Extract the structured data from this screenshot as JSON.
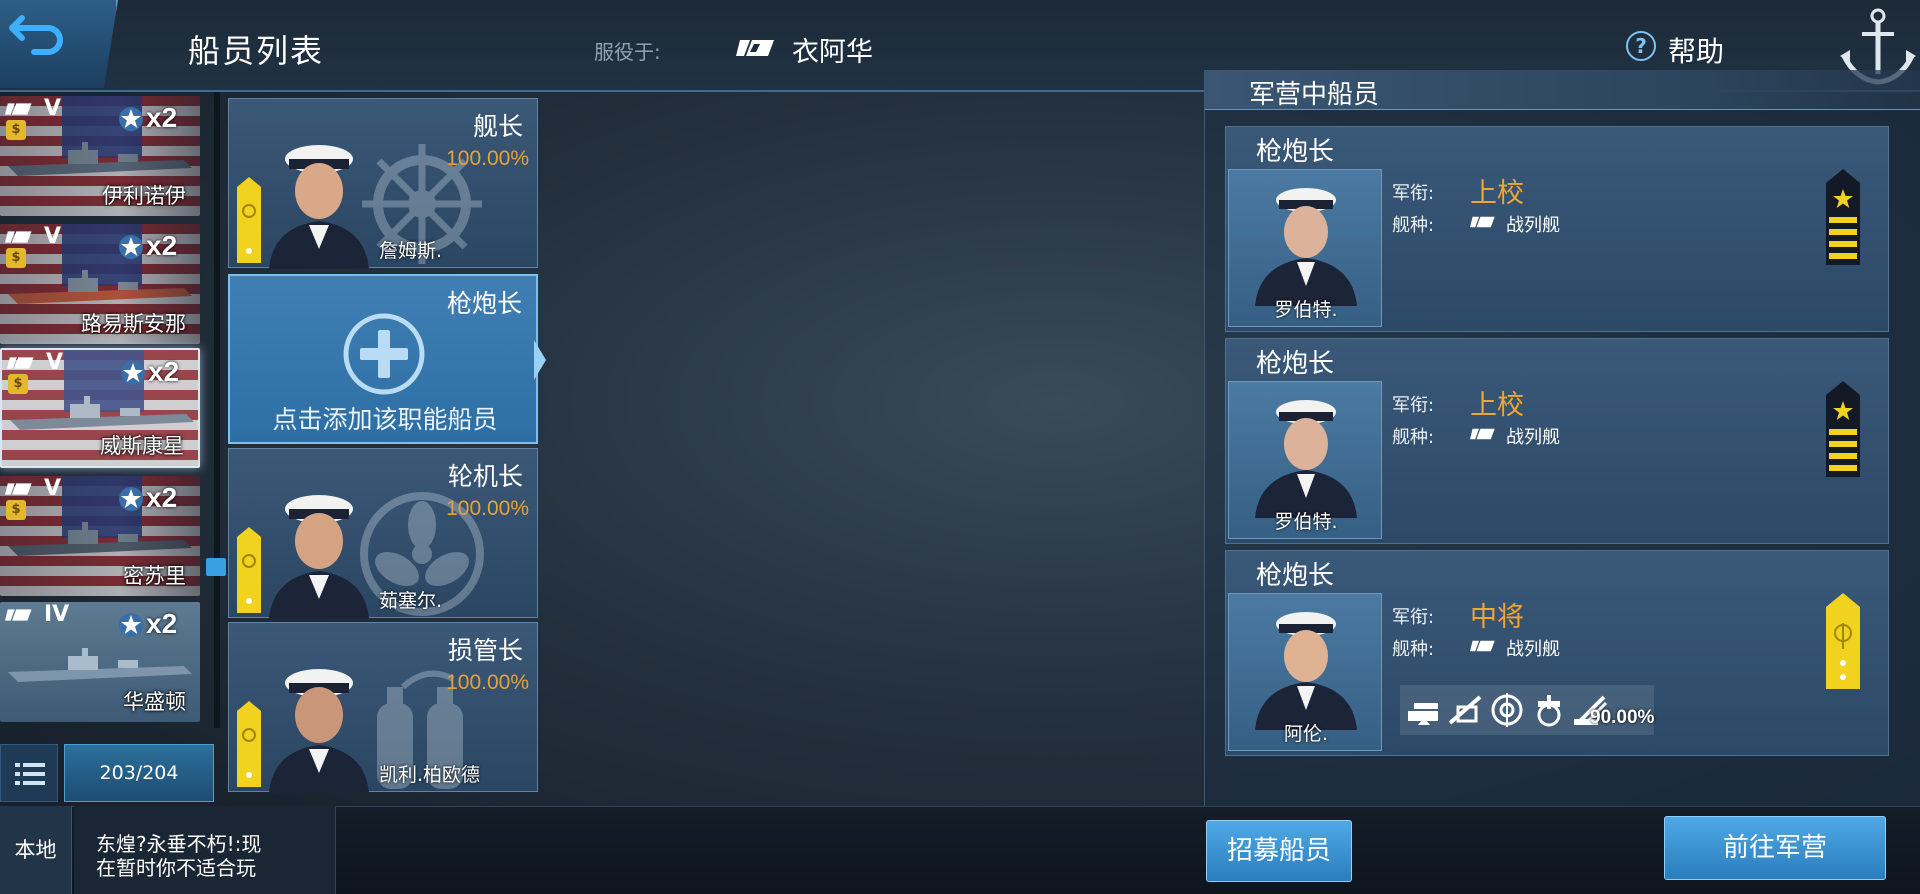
{
  "header": {
    "title": "船员列表",
    "served_label": "服役于:",
    "ship_name": "衣阿华",
    "help_label": "帮助"
  },
  "ship_list": {
    "items": [
      {
        "tier": "V",
        "name": "伊利诺伊",
        "multiplier": "x2",
        "selected": false
      },
      {
        "tier": "V",
        "name": "路易斯安那",
        "multiplier": "x2",
        "selected": false
      },
      {
        "tier": "V",
        "name": "威斯康星",
        "multiplier": "x2",
        "selected": true
      },
      {
        "tier": "V",
        "name": "密苏里",
        "multiplier": "x2",
        "selected": false
      },
      {
        "tier": "IV",
        "name": "华盛顿",
        "multiplier": "x2",
        "selected": false
      }
    ],
    "count": "203/204"
  },
  "crew_slots": [
    {
      "role": "舰长",
      "percent": "100.00%",
      "name": "詹姆斯.",
      "empty": false,
      "emblem": "ship-wheel"
    },
    {
      "role": "枪炮长",
      "empty": true,
      "hint": "点击添加该职能船员"
    },
    {
      "role": "轮机长",
      "percent": "100.00%",
      "name": "茹塞尔.",
      "empty": false,
      "emblem": "propeller"
    },
    {
      "role": "损管长",
      "percent": "100.00%",
      "name": "凯利.柏欧德",
      "empty": false,
      "emblem": "extinguisher"
    }
  ],
  "barracks": {
    "title": "军营中船员",
    "rank_label": "军衔:",
    "shiptype_label": "舰种:",
    "crew": [
      {
        "role": "枪炮长",
        "rank": "上校",
        "ship_type": "战列舰",
        "name": "罗伯特.",
        "insignia": "captain"
      },
      {
        "role": "枪炮长",
        "rank": "上校",
        "ship_type": "战列舰",
        "name": "罗伯特.",
        "insignia": "captain"
      },
      {
        "role": "枪炮长",
        "rank": "中将",
        "ship_type": "战列舰",
        "name": "阿伦.",
        "insignia": "vice-admiral",
        "skill_percent": "90.00%"
      }
    ]
  },
  "bottom": {
    "local_tab": "本地",
    "chat_line1": "东煌?永垂不朽!:现",
    "chat_line2": "在暂时你不适合玩",
    "recruit_button": "招募船员",
    "barracks_button": "前往军营"
  },
  "colors": {
    "accent_blue": "#3aa0e4",
    "rank_orange": "#f0a632",
    "percent_orange": "#e6a23a",
    "panel_blue": "#2c4967"
  }
}
